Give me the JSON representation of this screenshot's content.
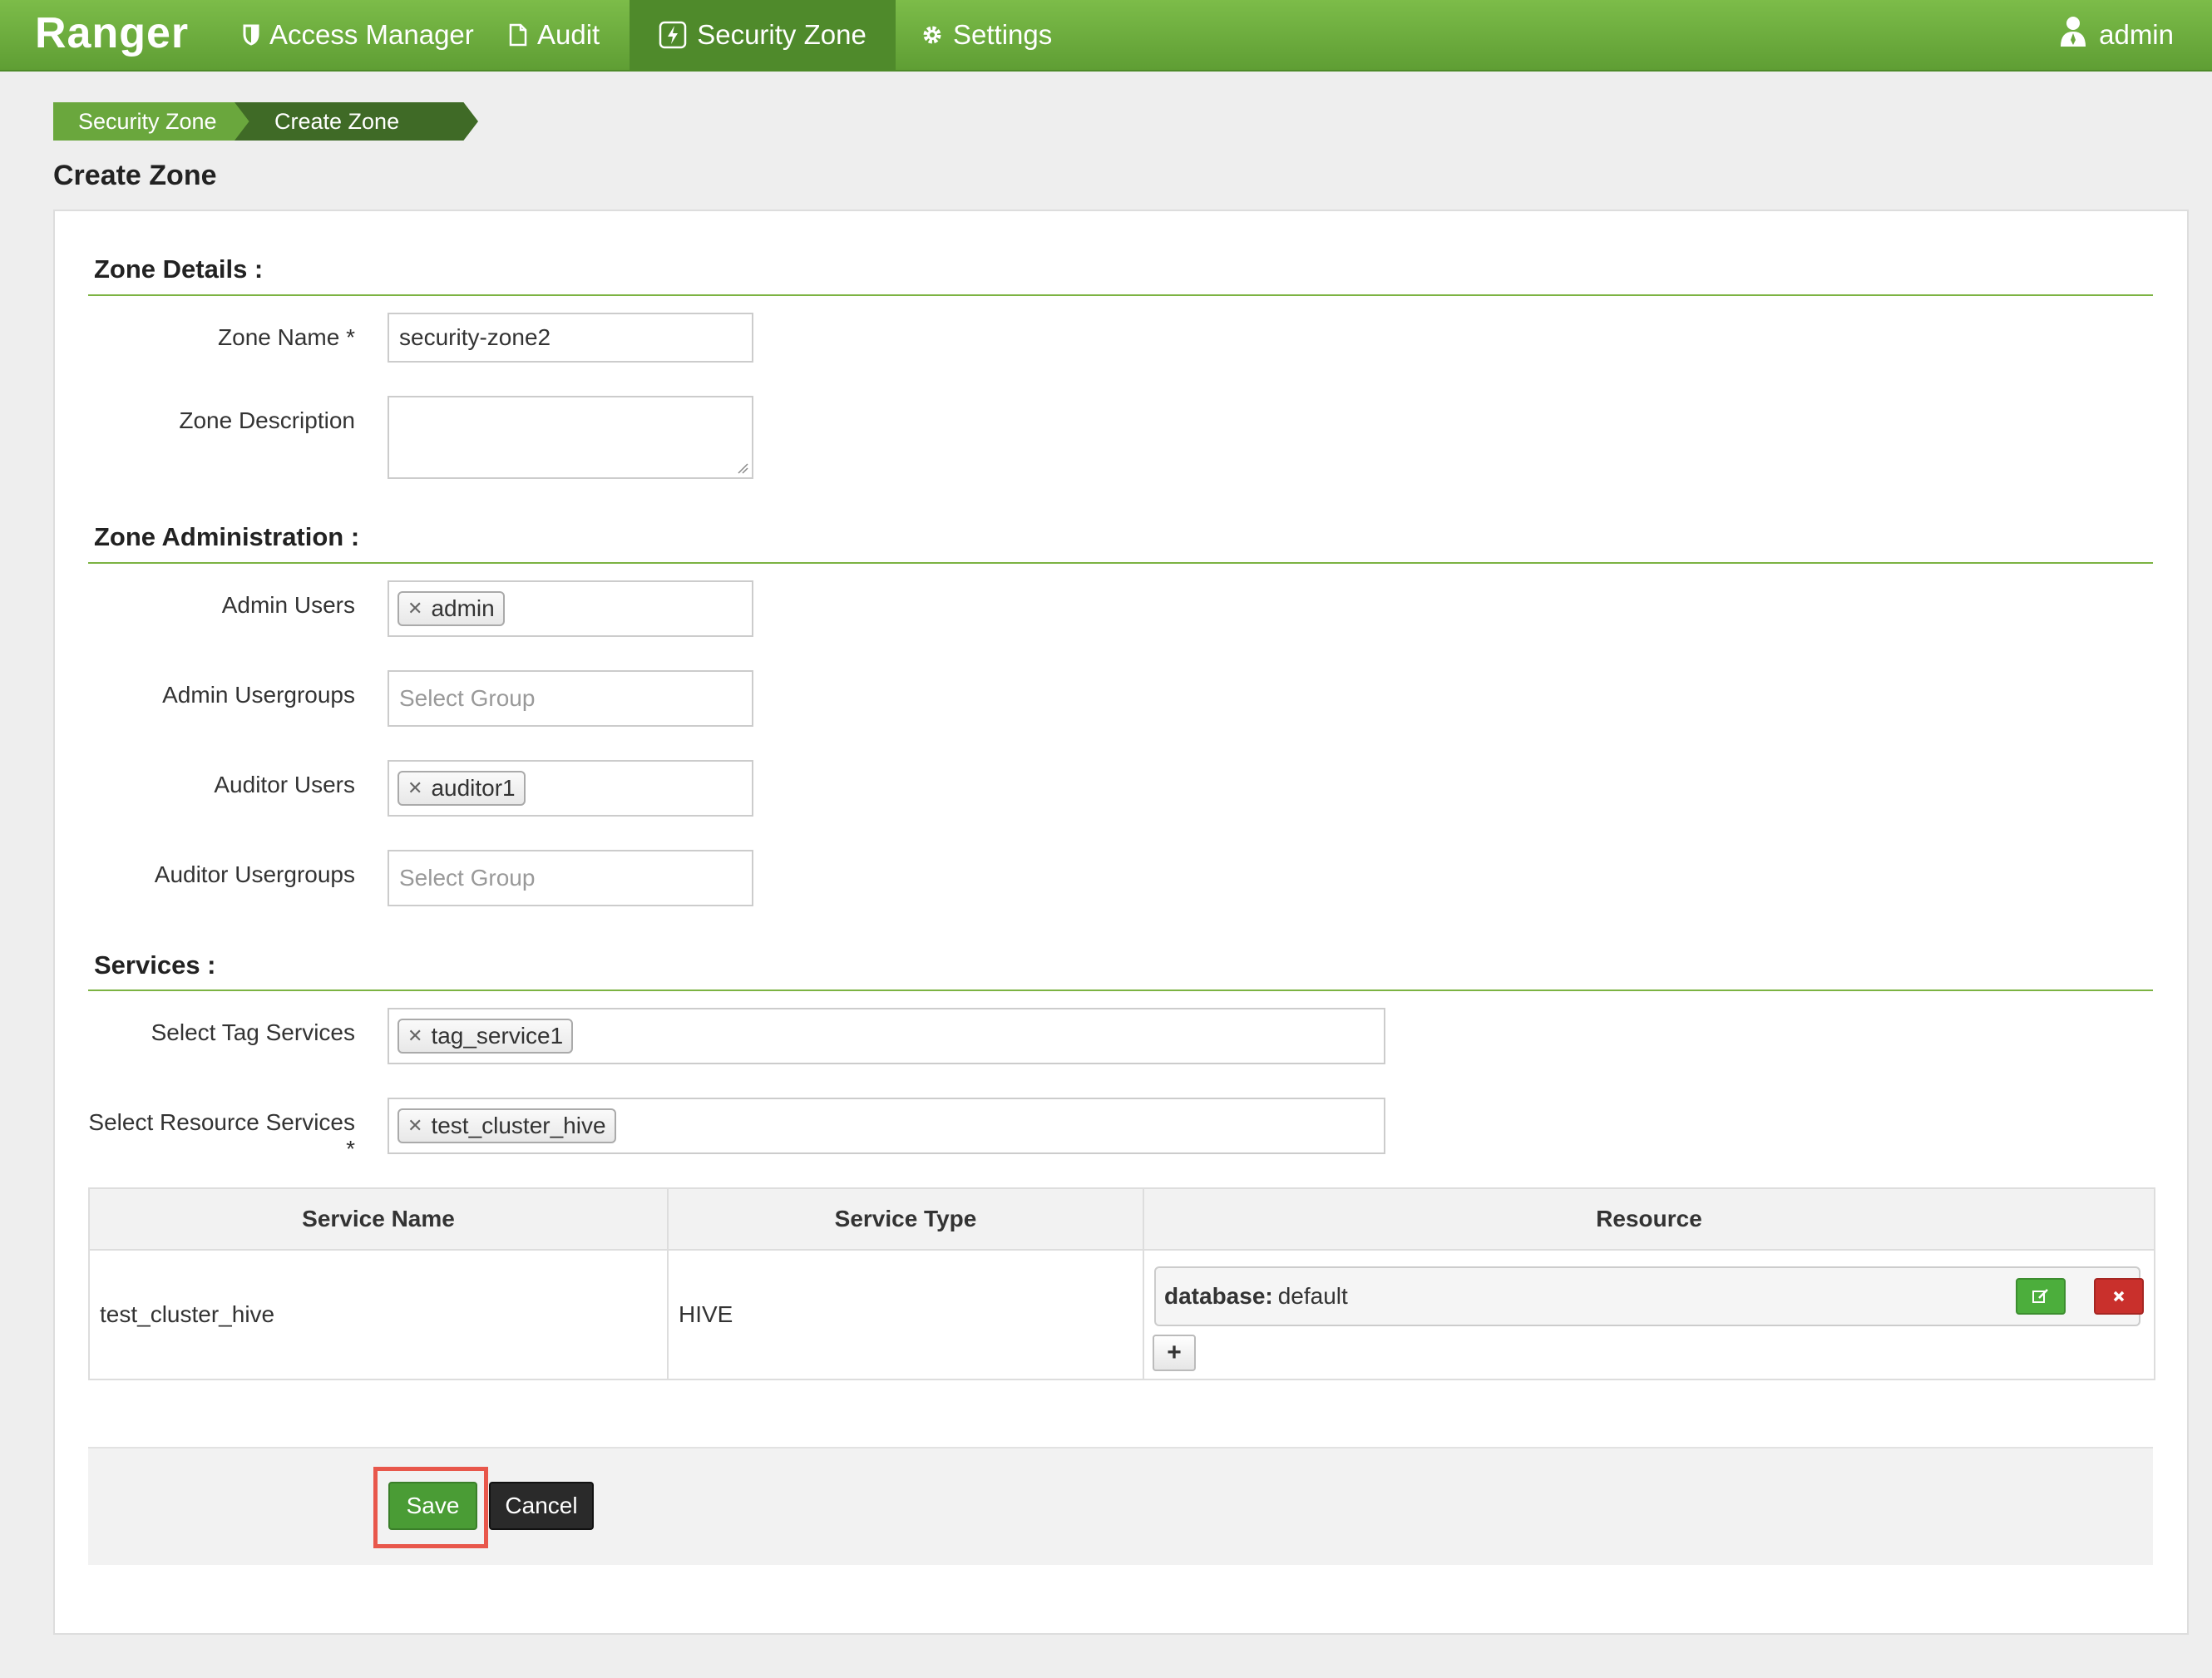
{
  "nav": {
    "brand": "Ranger",
    "access_manager": "Access Manager",
    "audit": "Audit",
    "security_zone": "Security Zone",
    "settings": "Settings",
    "user": "admin"
  },
  "breadcrumb": [
    "Security Zone",
    "Create Zone"
  ],
  "page_title": "Create Zone",
  "zone_details": {
    "title": "Zone Details :",
    "zone_name_label": "Zone Name *",
    "zone_name_value": "security-zone2",
    "zone_description_label": "Zone Description",
    "zone_description_value": ""
  },
  "zone_admin": {
    "title": "Zone Administration :",
    "admin_users_label": "Admin Users",
    "admin_users": [
      "admin"
    ],
    "admin_usergroups_label": "Admin Usergroups",
    "admin_usergroups_placeholder": "Select Group",
    "auditor_users_label": "Auditor Users",
    "auditor_users": [
      "auditor1"
    ],
    "auditor_usergroups_label": "Auditor Usergroups",
    "auditor_usergroups_placeholder": "Select Group"
  },
  "services": {
    "title": "Services :",
    "tag_services_label": "Select Tag Services",
    "tag_services": [
      "tag_service1"
    ],
    "resource_services_label": "Select Resource Services *",
    "resource_services": [
      "test_cluster_hive"
    ]
  },
  "table": {
    "headers": [
      "Service Name",
      "Service Type",
      "Resource"
    ],
    "rows": [
      {
        "service_name": "test_cluster_hive",
        "service_type": "HIVE",
        "resource_key": "database:",
        "resource_value": "default"
      }
    ]
  },
  "actions": {
    "save": "Save",
    "cancel": "Cancel",
    "add": "+"
  },
  "colors": {
    "nav_green": "#6aa73d",
    "save_green": "#4a9c35",
    "delete_red": "#c9302c",
    "highlight": "#e8574b"
  }
}
